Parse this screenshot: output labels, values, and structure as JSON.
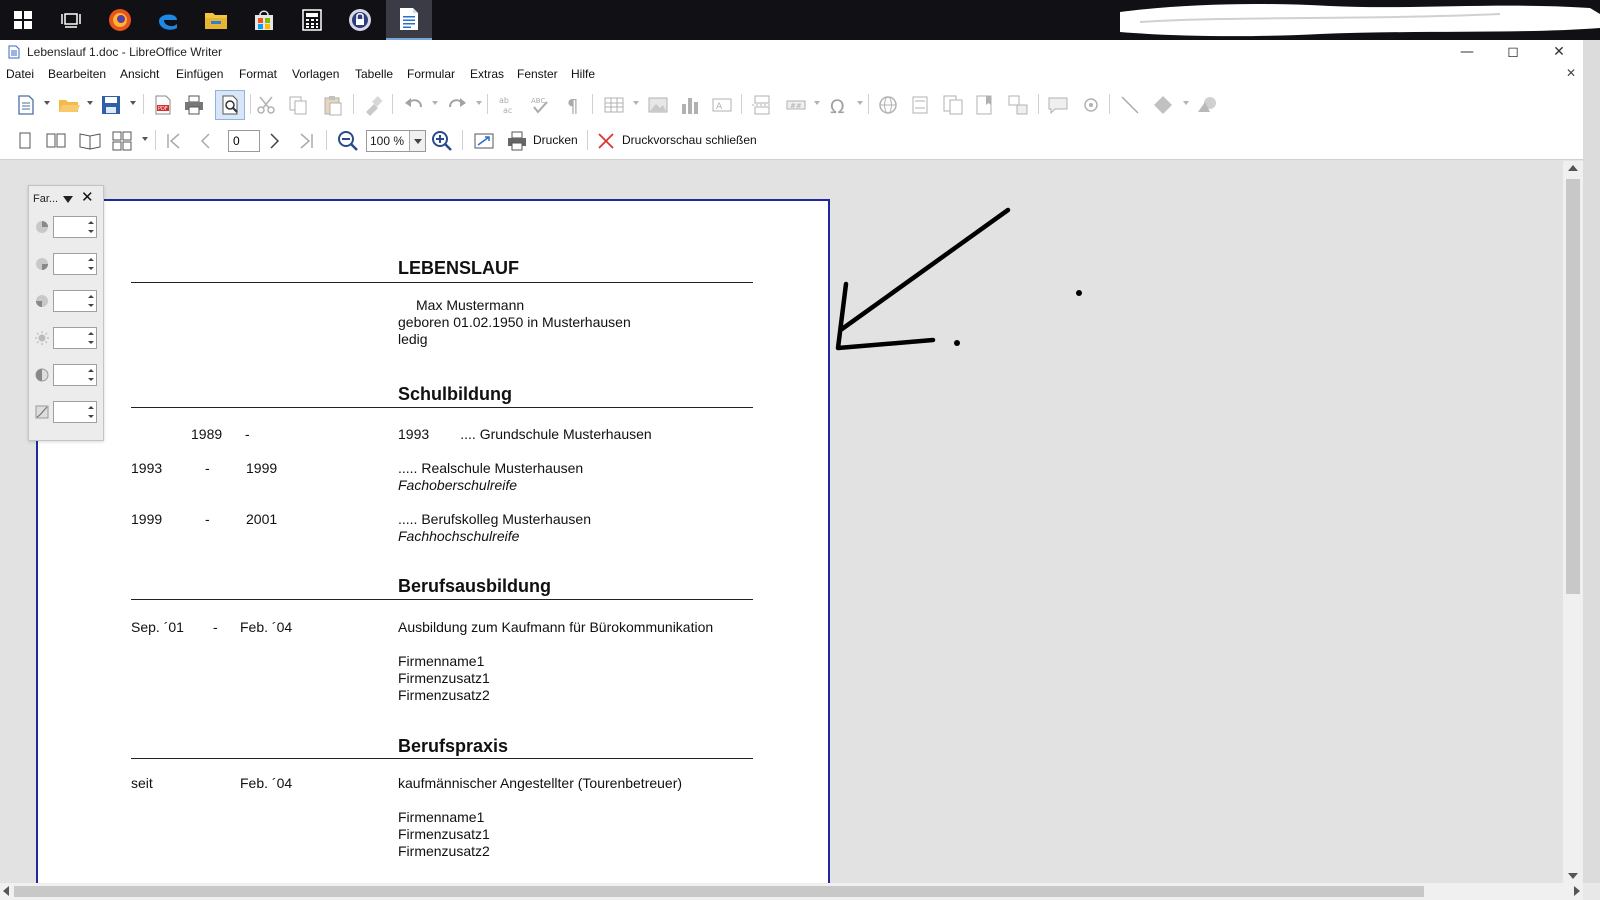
{
  "window": {
    "title": "Lebenslauf 1.doc - LibreOffice Writer"
  },
  "taskbar": {
    "items": [
      {
        "name": "start",
        "icon": "windows-logo-icon"
      },
      {
        "name": "task-view",
        "icon": "task-view-icon"
      },
      {
        "name": "firefox",
        "icon": "firefox-icon"
      },
      {
        "name": "edge",
        "icon": "edge-icon"
      },
      {
        "name": "explorer",
        "icon": "folder-icon"
      },
      {
        "name": "store",
        "icon": "store-icon"
      },
      {
        "name": "calculator",
        "icon": "calculator-icon"
      },
      {
        "name": "keepass",
        "icon": "lock-icon"
      },
      {
        "name": "writer",
        "icon": "writer-icon",
        "active": true
      }
    ]
  },
  "menu": {
    "datei": "Datei",
    "bearbeiten": "Bearbeiten",
    "ansicht": "Ansicht",
    "einfuegen": "Einfügen",
    "format": "Format",
    "vorlagen": "Vorlagen",
    "tabelle": "Tabelle",
    "formular": "Formular",
    "extras": "Extras",
    "fenster": "Fenster",
    "hilfe": "Hilfe"
  },
  "preview_toolbar": {
    "page_value": "0",
    "zoom_value": "100 %",
    "print_label": "Drucken",
    "close_preview_label": "Druckvorschau schließen"
  },
  "color_toolbar": {
    "title": "Far..."
  },
  "document": {
    "heading": "LEBENSLAUF",
    "name": "Max Mustermann",
    "born": "geboren 01.02.1950 in Musterhausen",
    "status": "ledig",
    "sections": {
      "schulbildung": {
        "title": "Schulbildung",
        "rows": [
          {
            "from": "1989",
            "dash": "-",
            "to": "",
            "desc": "1993        .... Grundschule Musterhausen",
            "sub": ""
          },
          {
            "from": "1993",
            "dash": "-",
            "to": "1999",
            "desc": "..... Realschule Musterhausen",
            "sub": "Fachoberschulreife"
          },
          {
            "from": "1999",
            "dash": "-",
            "to": "2001",
            "desc": "..... Berufskolleg Musterhausen",
            "sub": "Fachhochschulreife"
          }
        ]
      },
      "berufsausbildung": {
        "title": "Berufsausbildung",
        "from": "Sep. ´01",
        "dash": "-",
        "to": "Feb. ´04",
        "desc": "Ausbildung zum Kaufmann für Bürokommunikation",
        "lines": [
          "Firmenname1",
          "Firmenzusatz1",
          "Firmenzusatz2"
        ]
      },
      "berufspraxis": {
        "title": "Berufspraxis",
        "from": "seit",
        "to": "Feb. ´04",
        "desc": "kaufmännischer Angestellter (Tourenbetreuer)",
        "lines": [
          "Firmenname1",
          "Firmenzusatz1",
          "Firmenzusatz2"
        ]
      }
    }
  },
  "colors": {
    "taskbar": "#101015",
    "page_border": "#1f2a9a",
    "workspace": "#e2e2e2",
    "annotation": "#000000"
  }
}
